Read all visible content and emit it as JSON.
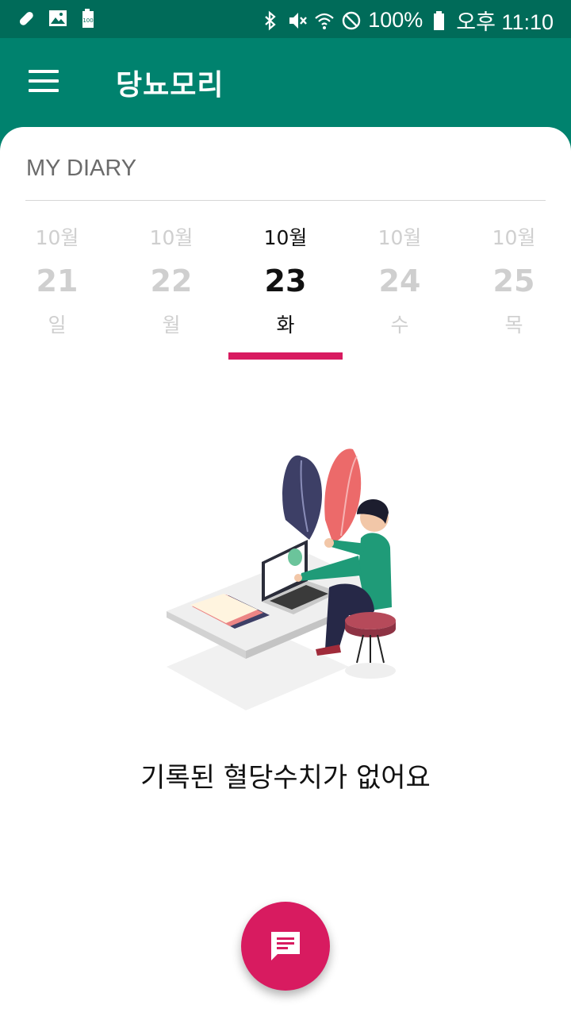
{
  "status_bar": {
    "battery_percent": "100%",
    "time": "오후 11:10",
    "icons": [
      "pill-icon",
      "image-icon",
      "battery-100-icon",
      "bluetooth-icon",
      "mute-icon",
      "wifi-icon",
      "do-not-disturb-icon",
      "battery-icon"
    ]
  },
  "app": {
    "title": "당뇨모리",
    "accent": "#00826e",
    "highlight": "#d81b60"
  },
  "diary": {
    "title": "MY DIARY",
    "days": [
      {
        "month": "10월",
        "day": "21",
        "weekday": "일",
        "selected": false
      },
      {
        "month": "10월",
        "day": "22",
        "weekday": "월",
        "selected": false
      },
      {
        "month": "10월",
        "day": "23",
        "weekday": "화",
        "selected": true
      },
      {
        "month": "10월",
        "day": "24",
        "weekday": "수",
        "selected": false
      },
      {
        "month": "10월",
        "day": "25",
        "weekday": "목",
        "selected": false
      }
    ]
  },
  "empty_state": {
    "message": "기록된 혈당수치가 없어요"
  },
  "fab": {
    "icon": "message-icon"
  }
}
